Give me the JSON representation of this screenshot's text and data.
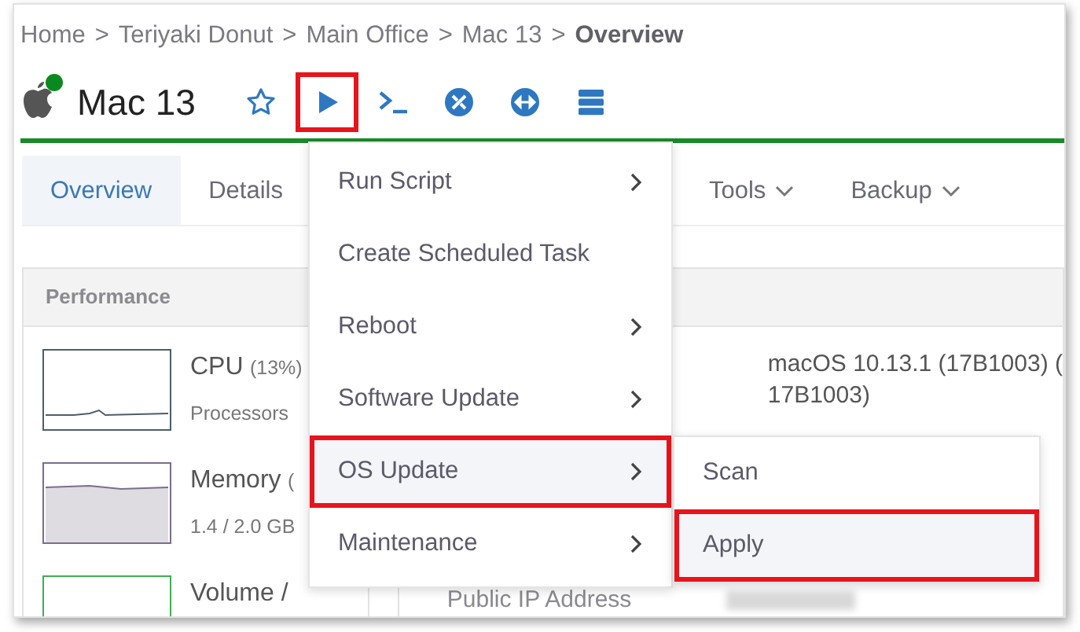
{
  "breadcrumb": {
    "items": [
      "Home",
      "Teriyaki Donut",
      "Main Office",
      "Mac 13"
    ],
    "separator": ">",
    "current": "Overview"
  },
  "device": {
    "name": "Mac 13",
    "online": true
  },
  "toolbar": [
    {
      "kind": "star",
      "highlighted": false
    },
    {
      "kind": "play",
      "highlighted": true
    },
    {
      "kind": "terminal",
      "highlighted": false
    },
    {
      "kind": "tools",
      "highlighted": false
    },
    {
      "kind": "remote",
      "highlighted": false
    },
    {
      "kind": "server",
      "highlighted": false
    }
  ],
  "tabs": [
    {
      "label": "Overview",
      "selected": true,
      "dropdown": false
    },
    {
      "label": "Details",
      "selected": false,
      "dropdown": false
    },
    {
      "label": "Tools",
      "selected": false,
      "dropdown": true
    },
    {
      "label": "Backup",
      "selected": false,
      "dropdown": true
    }
  ],
  "performance": {
    "title": "Performance",
    "metrics": [
      {
        "name": "CPU",
        "value": "(13%)",
        "detail": "Processors",
        "kind": "cpu"
      },
      {
        "name": "Memory",
        "value": "(",
        "detail": "1.4 / 2.0 GB",
        "kind": "memory"
      },
      {
        "name": "Volume /",
        "kind": "volume"
      }
    ]
  },
  "details": {
    "os_lines": [
      "macOS 10.13.1 (17B1003) (",
      "17B1003)"
    ],
    "rows": [
      {
        "label": "Public IP Address",
        "blurred": true
      }
    ]
  },
  "menu": {
    "items": [
      {
        "label": "Run Script",
        "submenu": true,
        "highlighted": false
      },
      {
        "label": "Create Scheduled Task",
        "submenu": false,
        "highlighted": false
      },
      {
        "label": "Reboot",
        "submenu": true,
        "highlighted": false
      },
      {
        "label": "Software Update",
        "submenu": true,
        "highlighted": false
      },
      {
        "label": "OS Update",
        "submenu": true,
        "highlighted": true
      },
      {
        "label": "Maintenance",
        "submenu": true,
        "highlighted": false
      }
    ]
  },
  "submenu": {
    "items": [
      {
        "label": "Scan",
        "highlighted": false
      },
      {
        "label": "Apply",
        "highlighted": true
      }
    ]
  }
}
